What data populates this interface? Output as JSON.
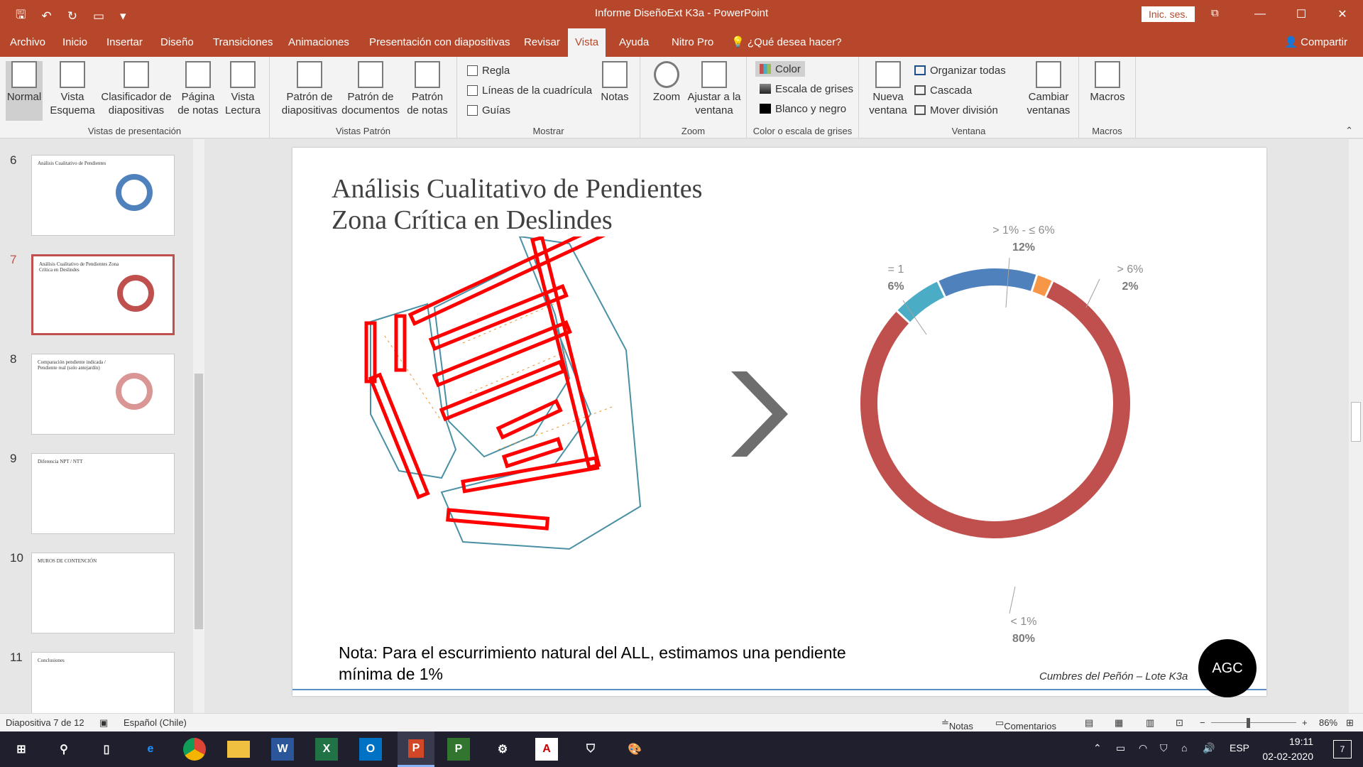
{
  "titlebar": {
    "title": "Informe DiseñoExt K3a  -  PowerPoint",
    "signin": "Inic. ses.",
    "qat": {
      "save": "🖫",
      "undo": "↶",
      "redo": "↻",
      "present": "▭",
      "more": "▾"
    },
    "win": {
      "display": "⧉",
      "min": "—",
      "max": "☐",
      "close": "✕"
    }
  },
  "tabs": [
    "Archivo",
    "Inicio",
    "Insertar",
    "Diseño",
    "Transiciones",
    "Animaciones",
    "Presentación con diapositivas",
    "Revisar",
    "Vista",
    "Ayuda",
    "Nitro Pro"
  ],
  "active_tab": "Vista",
  "tell_me": "¿Qué desea hacer?",
  "share": "Compartir",
  "ribbon": {
    "groups": {
      "vistas": "Vistas de presentación",
      "patron": "Vistas Patrón",
      "mostrar": "Mostrar",
      "zoom": "Zoom",
      "color": "Color o escala de grises",
      "ventana": "Ventana",
      "macros": "Macros"
    },
    "buttons": {
      "normal": "Normal",
      "esquema": "Vista Esquema",
      "clasificador": "Clasificador de diapositivas",
      "pagina_notas": "Página de notas",
      "lectura": "Vista Lectura",
      "patron_diap": "Patrón de diapositivas",
      "patron_doc": "Patrón de documentos",
      "patron_notas": "Patrón de notas",
      "regla": "Regla",
      "cuadricula": "Líneas de la cuadrícula",
      "guias": "Guías",
      "notas": "Notas",
      "zoom": "Zoom",
      "ajustar": "Ajustar a la ventana",
      "color": "Color",
      "grises": "Escala de grises",
      "blanco_negro": "Blanco y negro",
      "nueva_ventana": "Nueva ventana",
      "organizar": "Organizar todas",
      "cascada": "Cascada",
      "mover": "Mover división",
      "cambiar": "Cambiar ventanas",
      "macros": "Macros"
    }
  },
  "thumbnails": [
    {
      "num": "6",
      "title": "Análisis Cualitativo de Pendientes"
    },
    {
      "num": "7",
      "title": "Análisis Cualitativo de Pendientes Zona Crítica en Deslindes"
    },
    {
      "num": "8",
      "title": "Comparación pendiente indicada / Pendiente real (solo antejardín)"
    },
    {
      "num": "9",
      "title": "Diferencia NPT / NTT"
    },
    {
      "num": "10",
      "title": "MUROS DE CONTENCIÓN"
    },
    {
      "num": "11",
      "title": "Conclusiones"
    }
  ],
  "slide": {
    "title_line1": "Análisis Cualitativo de Pendientes",
    "title_line2": "Zona Crítica en Deslindes",
    "note_line1": "Nota: Para el escurrimiento natural del ALL, estimamos una pendiente",
    "note_line2": "mínima de 1%",
    "footer": "Cumbres del Peñón – Lote K3a",
    "logo": "AGC",
    "arrow": "›"
  },
  "chart_data": {
    "type": "pie",
    "subtype": "donut",
    "categories": [
      "< 1%",
      "= 1",
      "> 1% - ≤ 6%",
      "> 6%"
    ],
    "values": [
      80,
      6,
      12,
      2
    ],
    "labels": [
      "80%",
      "6%",
      "12%",
      "2%"
    ],
    "colors": [
      "#c0504d",
      "#4bacc6",
      "#4f81bd",
      "#f79646"
    ]
  },
  "status": {
    "slide": "Diapositiva 7 de 12",
    "lang": "Español (Chile)",
    "notes": "Notas",
    "comments": "Comentarios",
    "zoom": "86%"
  },
  "taskbar": {
    "lang": "ESP",
    "time": "19:11",
    "date": "02-02-2020",
    "notif": "7"
  }
}
